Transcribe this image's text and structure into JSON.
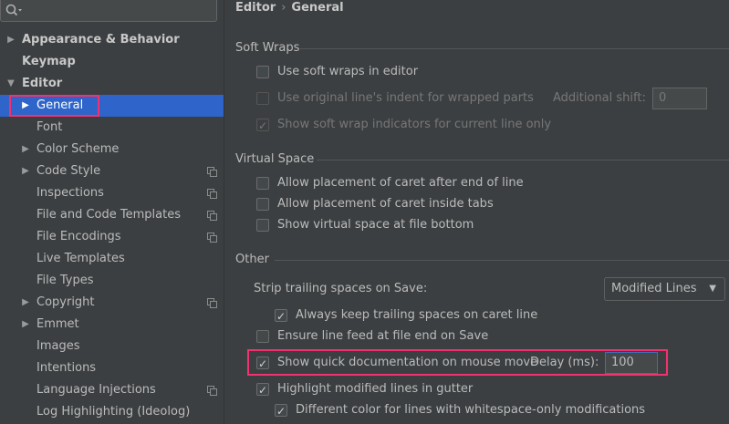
{
  "sidebar": {
    "search": {
      "placeholder": "",
      "value": ""
    },
    "items": [
      {
        "label": "Appearance & Behavior",
        "level": 0,
        "arrow": "▶",
        "bold": true
      },
      {
        "label": "Keymap",
        "level": 0,
        "arrow": "",
        "bold": true
      },
      {
        "label": "Editor",
        "level": 0,
        "arrow": "▼",
        "bold": true
      },
      {
        "label": "General",
        "level": 1,
        "arrow": "▶",
        "selected": true
      },
      {
        "label": "Font",
        "level": 1,
        "arrow": ""
      },
      {
        "label": "Color Scheme",
        "level": 1,
        "arrow": "▶"
      },
      {
        "label": "Code Style",
        "level": 1,
        "arrow": "▶",
        "project": true
      },
      {
        "label": "Inspections",
        "level": 1,
        "arrow": "",
        "project": true
      },
      {
        "label": "File and Code Templates",
        "level": 1,
        "arrow": "",
        "project": true
      },
      {
        "label": "File Encodings",
        "level": 1,
        "arrow": "",
        "project": true
      },
      {
        "label": "Live Templates",
        "level": 1,
        "arrow": ""
      },
      {
        "label": "File Types",
        "level": 1,
        "arrow": ""
      },
      {
        "label": "Copyright",
        "level": 1,
        "arrow": "▶",
        "project": true
      },
      {
        "label": "Emmet",
        "level": 1,
        "arrow": "▶"
      },
      {
        "label": "Images",
        "level": 1,
        "arrow": ""
      },
      {
        "label": "Intentions",
        "level": 1,
        "arrow": ""
      },
      {
        "label": "Language Injections",
        "level": 1,
        "arrow": "",
        "project": true
      },
      {
        "label": "Log Highlighting (Ideolog)",
        "level": 1,
        "arrow": ""
      }
    ]
  },
  "breadcrumb": {
    "root": "Editor",
    "separator": "›",
    "current": "General"
  },
  "soft_wraps": {
    "title": "Soft Wraps",
    "use_soft_wraps": "Use soft wraps in editor",
    "use_original_indent": "Use original line's indent for wrapped parts",
    "additional_shift_label": "Additional shift:",
    "additional_shift_value": "0",
    "show_indicators": "Show soft wrap indicators for current line only"
  },
  "virtual_space": {
    "title": "Virtual Space",
    "after_end": "Allow placement of caret after end of line",
    "inside_tabs": "Allow placement of caret inside tabs",
    "file_bottom": "Show virtual space at file bottom"
  },
  "other": {
    "title": "Other",
    "strip_label": "Strip trailing spaces on Save:",
    "strip_value": "Modified Lines",
    "keep_trailing": "Always keep trailing spaces on caret line",
    "ensure_line_feed": "Ensure line feed at file end on Save",
    "quick_doc": "Show quick documentation on mouse move",
    "delay_label": "Delay (ms):",
    "delay_value": "100",
    "highlight_modified": "Highlight modified lines in gutter",
    "different_color": "Different color for lines with whitespace-only modifications"
  },
  "colors": {
    "selection": "#2f65ca",
    "highlight_box": "#f0326e",
    "background": "#3c3f41"
  }
}
